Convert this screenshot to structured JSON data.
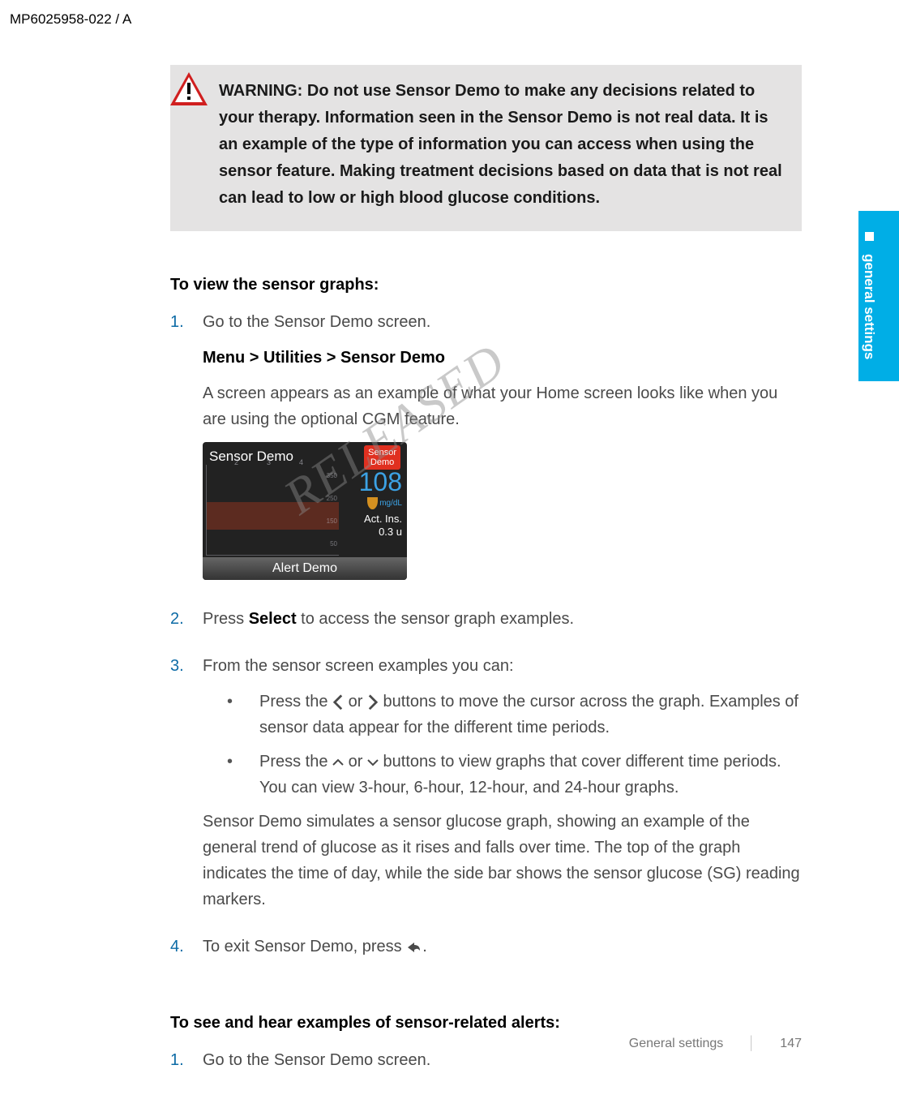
{
  "document": {
    "id_header": "MP6025958-022 / A"
  },
  "warning": {
    "label": "WARNING:",
    "text": "Do not use Sensor Demo to make any decisions related to your therapy. Information seen in the Sensor Demo is not real data. It is an example of the type of information you can access when using the sensor feature. Making treatment decisions based on data that is not real can lead to low or high blood glucose conditions."
  },
  "section1": {
    "heading": "To view the sensor graphs:",
    "step1": {
      "num": "1.",
      "text": "Go to the Sensor Demo screen.",
      "breadcrumb": "Menu > Utilities > Sensor Demo",
      "desc": "A screen appears as an example of what your Home screen looks like when you are using the optional CGM feature."
    },
    "step2": {
      "num": "2.",
      "text_before": "Press ",
      "select_word": "Select",
      "text_after": " to access the sensor graph examples."
    },
    "step3": {
      "num": "3.",
      "intro": "From the sensor screen examples you can:",
      "bullet1_before": "Press the ",
      "bullet1_mid": " or ",
      "bullet1_after": " buttons to move the cursor across the graph. Examples of sensor data appear for the different time periods.",
      "bullet2_before": "Press the ",
      "bullet2_mid": " or ",
      "bullet2_after": " buttons to view graphs that cover different time periods. You can view 3-hour, 6-hour, 12-hour, and 24-hour graphs.",
      "desc": "Sensor Demo simulates a sensor glucose graph, showing an example of the general trend of glucose as it rises and falls over time. The top of the graph indicates the time of day, while the side bar shows the sensor glucose (SG) reading markers."
    },
    "step4": {
      "num": "4.",
      "text_before": "To exit Sensor Demo, press ",
      "text_after": "."
    }
  },
  "section2": {
    "heading": "To see and hear examples of sensor-related alerts:",
    "step1": {
      "num": "1.",
      "text": "Go to the Sensor Demo screen."
    }
  },
  "device": {
    "title": "Sensor Demo",
    "pill_line1": "Sensor",
    "pill_line2": "Demo",
    "value": "108",
    "unit": "mg/dL",
    "act_ins_label": "Act. Ins.",
    "act_ins_value": "0.3 u",
    "alert_bar": "Alert Demo",
    "y_axis": [
      "350",
      "250",
      "150",
      "50"
    ],
    "x_axis": [
      "2",
      "3",
      "4"
    ]
  },
  "watermark": "RELEASED",
  "side_tab": "general settings",
  "footer": {
    "label": "General settings",
    "page": "147"
  }
}
